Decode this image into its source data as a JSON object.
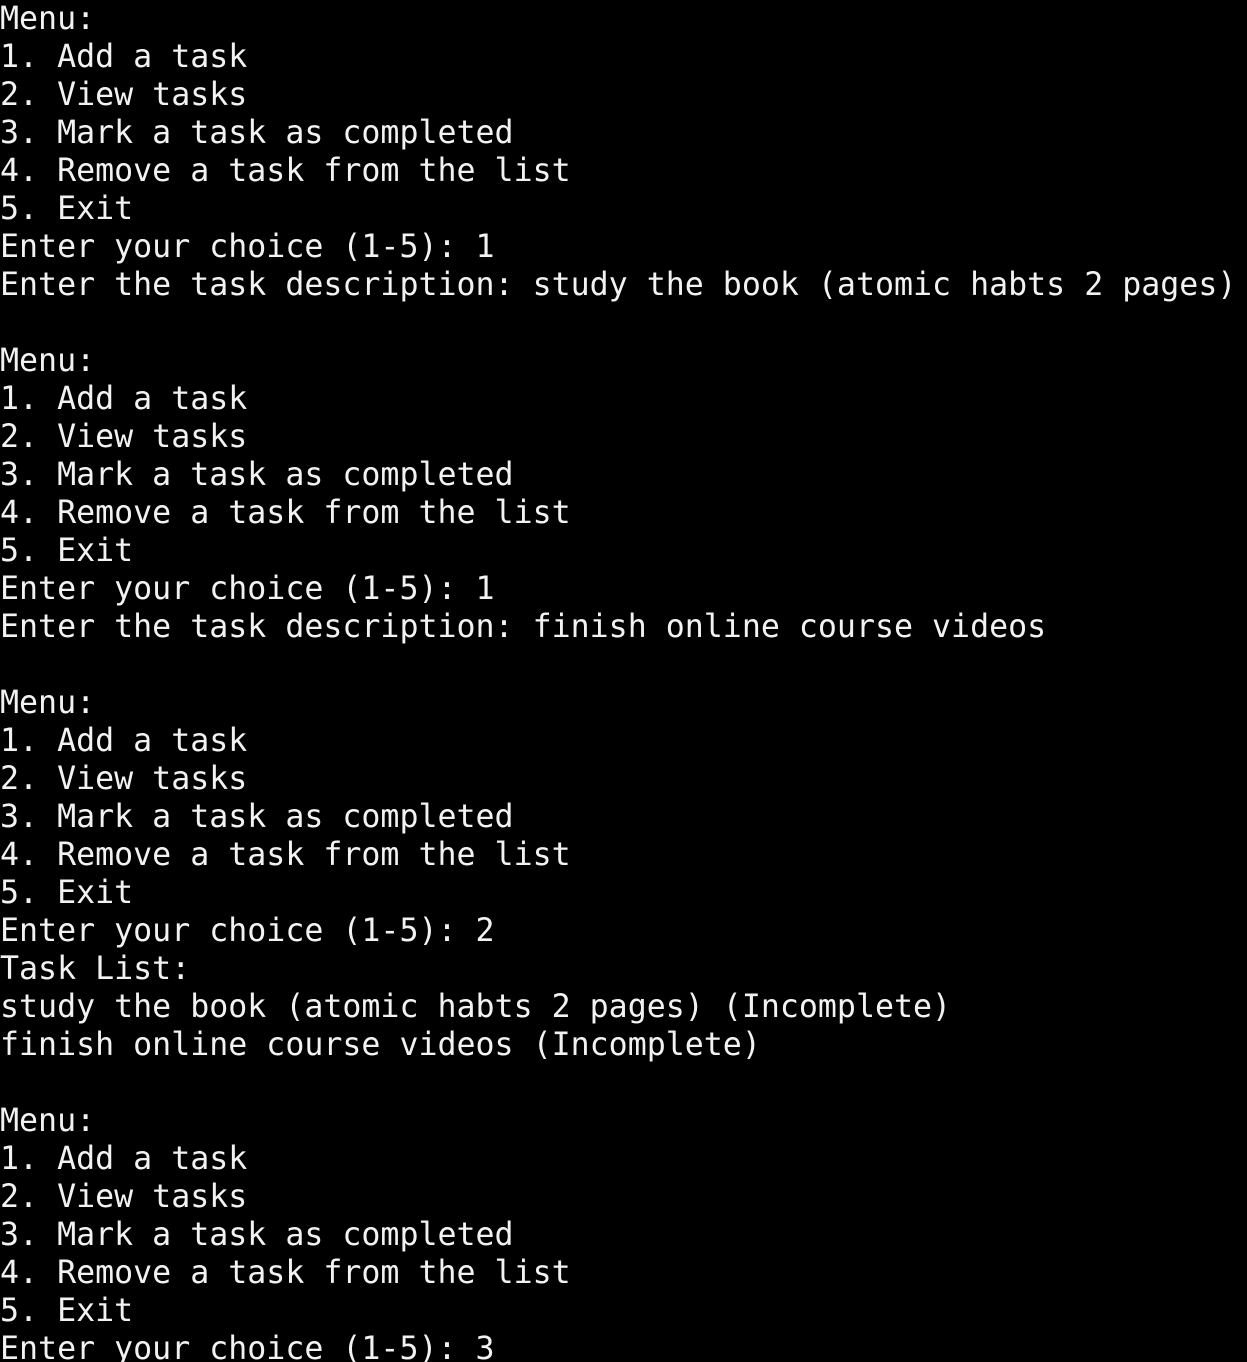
{
  "terminal": {
    "background_color": "#000000",
    "text_color": "#f2f2f2",
    "prompt_menu_title": "Menu:",
    "menu_options": [
      "1. Add a task",
      "2. View tasks",
      "3. Mark a task as completed",
      "4. Remove a task from the list",
      "5. Exit"
    ],
    "choice_prompt": "Enter your choice (1-5): ",
    "description_prompt": "Enter the task description: ",
    "task_list_header": "Task List:",
    "tasks": [
      "study the book (atomic habts 2 pages)",
      "finish online course videos"
    ],
    "status_incomplete": "(Incomplete)",
    "choices_entered": [
      "1",
      "1",
      "2",
      "3"
    ],
    "lines": [
      "Menu:",
      "1. Add a task",
      "2. View tasks",
      "3. Mark a task as completed",
      "4. Remove a task from the list",
      "5. Exit",
      "Enter your choice (1-5): 1",
      "Enter the task description: study the book (atomic habts 2 pages)",
      "",
      "Menu:",
      "1. Add a task",
      "2. View tasks",
      "3. Mark a task as completed",
      "4. Remove a task from the list",
      "5. Exit",
      "Enter your choice (1-5): 1",
      "Enter the task description: finish online course videos",
      "",
      "Menu:",
      "1. Add a task",
      "2. View tasks",
      "3. Mark a task as completed",
      "4. Remove a task from the list",
      "5. Exit",
      "Enter your choice (1-5): 2",
      "Task List:",
      "study the book (atomic habts 2 pages) (Incomplete)",
      "finish online course videos (Incomplete)",
      "",
      "Menu:",
      "1. Add a task",
      "2. View tasks",
      "3. Mark a task as completed",
      "4. Remove a task from the list",
      "5. Exit",
      "Enter your choice (1-5): 3"
    ]
  }
}
